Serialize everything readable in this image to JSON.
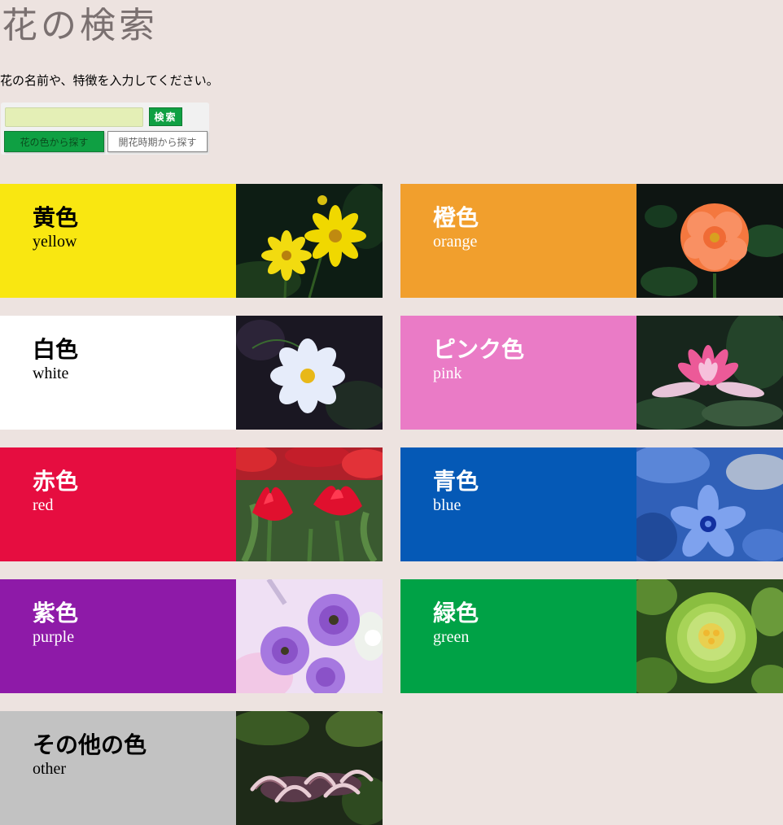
{
  "header": {
    "title": "花の検索",
    "intro": "花の名前や、特徴を入力してください。"
  },
  "search": {
    "value": "",
    "button_label": "検索",
    "mode_color_label": "花の色から探す",
    "mode_season_label": "開花時期から探す"
  },
  "colors": {
    "yellow": {
      "ja": "黄色",
      "en": "yellow",
      "bg": "#f9e711",
      "text": "#000000"
    },
    "orange": {
      "ja": "橙色",
      "en": "orange",
      "bg": "#f19f2d",
      "text": "#ffffff"
    },
    "white": {
      "ja": "白色",
      "en": "white",
      "bg": "#ffffff",
      "text": "#000000"
    },
    "pink": {
      "ja": "ピンク色",
      "en": "pink",
      "bg": "#ea7bc6",
      "text": "#ffffff"
    },
    "red": {
      "ja": "赤色",
      "en": "red",
      "bg": "#e60d40",
      "text": "#ffffff"
    },
    "blue": {
      "ja": "青色",
      "en": "blue",
      "bg": "#0559b6",
      "text": "#ffffff"
    },
    "purple": {
      "ja": "紫色",
      "en": "purple",
      "bg": "#8e1aa8",
      "text": "#ffffff"
    },
    "green": {
      "ja": "緑色",
      "en": "green",
      "bg": "#00a246",
      "text": "#ffffff"
    },
    "other": {
      "ja": "その他の色",
      "en": "other",
      "bg": "#c2c2c2",
      "text": "#000000"
    }
  }
}
